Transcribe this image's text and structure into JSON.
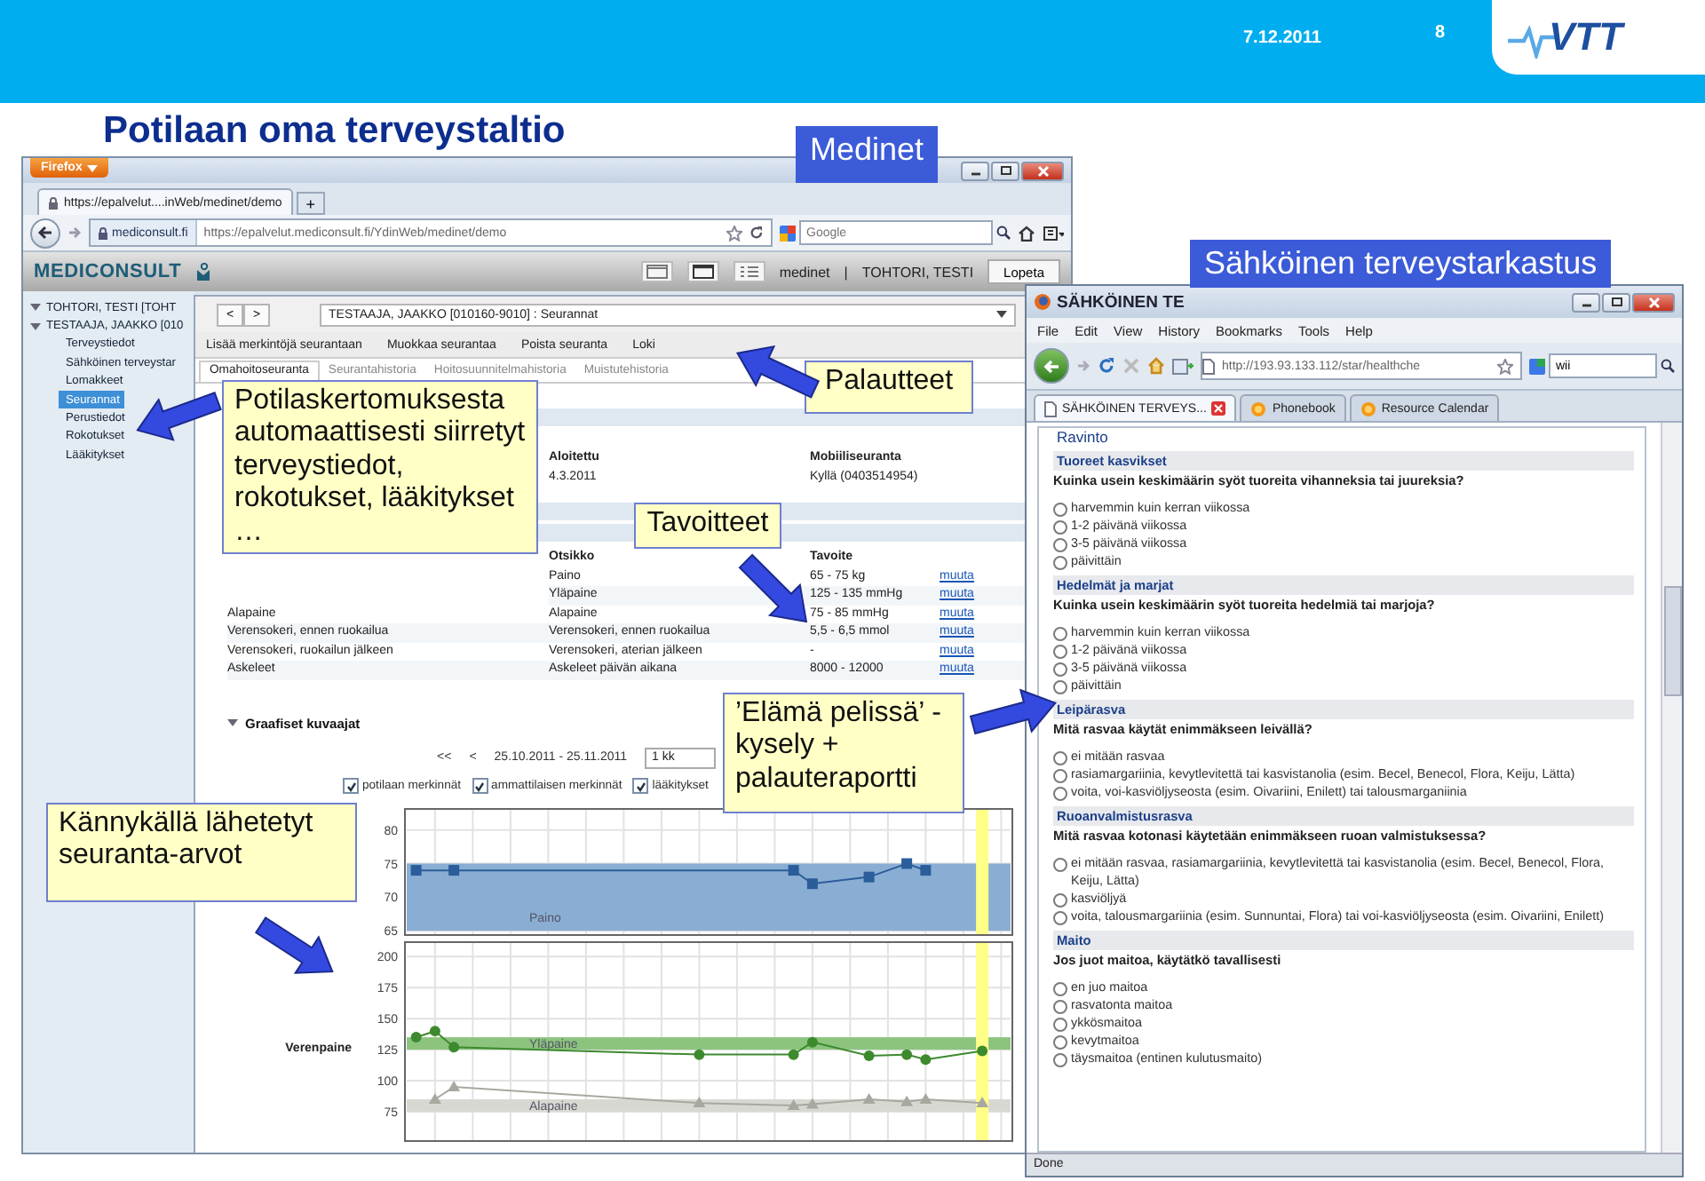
{
  "slide": {
    "date": "7.12.2011",
    "page": "8",
    "logo": "VTT",
    "title": "Potilaan oma terveystaltio"
  },
  "medinet_window": {
    "browser_button": "Firefox",
    "tabs": [
      {
        "label": "https://epalvelut....inWeb/medinet/demo",
        "selected": true
      }
    ],
    "new_tab": "+",
    "site_badge": "mediconsult.fi",
    "url": "https://epalvelut.mediconsult.fi/YdinWeb/medinet/demo",
    "search": {
      "placeholder": "Google"
    },
    "app_header": {
      "logo": "MEDICONSULT",
      "app": "medinet",
      "separator": "|",
      "user": "TOHTORI, TESTI",
      "logout": "Lopeta"
    },
    "sidebar": [
      {
        "label": "TOHTORI, TESTI [TOHT",
        "expanded": true,
        "selected": false
      },
      {
        "label": "TESTAAJA, JAAKKO [010",
        "expanded": true,
        "selected": false,
        "children": [
          {
            "label": "Terveystiedot",
            "selected": false
          },
          {
            "label": "Sähköinen terveystar",
            "selected": false
          },
          {
            "label": "Lomakkeet",
            "selected": false
          },
          {
            "label": "Seurannat",
            "selected": true
          },
          {
            "label": "Perustiedot",
            "selected": false
          },
          {
            "label": "Rokotukset",
            "selected": false
          },
          {
            "label": "Lääkitykset",
            "selected": false
          }
        ]
      }
    ],
    "nav_buttons": [
      "<",
      ">"
    ],
    "record_select": "TESTAAJA, JAAKKO  [010160-9010] : Seurannat",
    "actions": [
      "Lisää merkintöjä seurantaan",
      "Muokkaa seurantaa",
      "Poista seuranta",
      "Loki"
    ],
    "tabs2": [
      {
        "label": "Omahoitoseuranta",
        "selected": true
      },
      {
        "label": "Seurantahistoria",
        "selected": false
      },
      {
        "label": "Hoitosuunnitelmahistoria",
        "selected": false
      },
      {
        "label": "Muistutehistoria",
        "selected": false
      }
    ],
    "info": [
      {
        "label": "Aloitettu",
        "value": "4.3.2011"
      },
      {
        "label": "Mobiiliseuranta",
        "value": "Kyllä (0403514954)"
      }
    ],
    "targets": {
      "columns": [
        "Otsikko",
        "Tavoite"
      ],
      "rows": [
        {
          "title": "Paino",
          "target": "65 - 75 kg",
          "link": "muuta"
        },
        {
          "title": "Yläpaine",
          "target": "125 - 135 mmHg",
          "link": "muuta"
        },
        {
          "measure": "Alapaine",
          "title": "Alapaine",
          "target": "75 - 85 mmHg",
          "link": "muuta"
        },
        {
          "measure": "Verensokeri, ennen ruokailua",
          "title": "Verensokeri, ennen ruokailua",
          "target": "5,5 - 6,5 mmol",
          "link": "muuta"
        },
        {
          "measure": "Verensokeri, ruokailun jälkeen",
          "title": "Verensokeri, aterian jälkeen",
          "target": "-",
          "link": "muuta"
        },
        {
          "measure": "Askeleet",
          "title": "Askeleet päivän aikana",
          "target": "8000 - 12000",
          "link": "muuta"
        }
      ]
    },
    "graphs": {
      "heading": "Graafiset kuvaajat",
      "expanded": true,
      "nav": [
        "<<",
        "<"
      ],
      "range": "25.10.2011 - 25.11.2011",
      "period": "1 kk",
      "filters": [
        {
          "label": "potilaan merkinnät",
          "checked": true
        },
        {
          "label": "ammattilaisen merkinnät",
          "checked": true
        },
        {
          "label": "lääkitykset",
          "checked": true
        }
      ],
      "charts": [
        {
          "chart_data": {
            "type": "line",
            "categories": [
              null,
              null,
              null,
              null,
              null,
              null,
              null,
              null,
              null,
              null,
              null,
              null,
              null,
              null,
              null,
              null,
              null,
              null,
              null,
              null,
              null,
              null,
              null,
              null,
              null,
              null,
              null,
              null,
              null,
              null,
              null,
              null
            ],
            "ylim": [
              64.5,
              83
            ],
            "yticks": [
              65,
              70,
              75,
              80
            ],
            "series": [
              {
                "name": "Paino",
                "color": "#2a5d9a",
                "marker": "square",
                "values": [
                  74,
                  null,
                  74,
                  null,
                  null,
                  null,
                  null,
                  null,
                  null,
                  null,
                  null,
                  null,
                  null,
                  null,
                  null,
                  null,
                  null,
                  null,
                  null,
                  null,
                  74,
                  72,
                  null,
                  null,
                  73,
                  null,
                  75,
                  74,
                  null,
                  null,
                  null,
                  null
                ]
              }
            ],
            "grid": true,
            "bands": [
              {
                "axis": "y",
                "from": 65,
                "to": 75,
                "color": "#8aaed3"
              }
            ]
          }
        },
        {
          "chart_data": {
            "type": "line",
            "ylabel": "Verenpaine",
            "categories": [
              null,
              null,
              null,
              null,
              null,
              null,
              null,
              null,
              null,
              null,
              null,
              null,
              null,
              null,
              null,
              null,
              null,
              null,
              null,
              null,
              null,
              null,
              null,
              null,
              null,
              null,
              null,
              null,
              null,
              null,
              null,
              null
            ],
            "ylim": [
              52,
              211
            ],
            "yticks": [
              75,
              100,
              125,
              150,
              175,
              200
            ],
            "series": [
              {
                "name": "Yläpaine",
                "color": "#3d8a2e",
                "marker": "circle",
                "values": [
                  135,
                  140,
                  127,
                  null,
                  null,
                  null,
                  null,
                  null,
                  null,
                  null,
                  null,
                  null,
                  null,
                  null,
                  null,
                  121,
                  null,
                  null,
                  null,
                  null,
                  121,
                  131,
                  null,
                  null,
                  120,
                  null,
                  121,
                  117,
                  null,
                  null,
                  124,
                  null
                ]
              },
              {
                "name": "Alapaine",
                "color": "#a8a8a0",
                "marker": "triangle",
                "values": [
                  null,
                  85,
                  95,
                  null,
                  null,
                  null,
                  null,
                  null,
                  null,
                  null,
                  null,
                  null,
                  null,
                  null,
                  null,
                  82,
                  null,
                  null,
                  null,
                  null,
                  80,
                  81,
                  null,
                  null,
                  85,
                  null,
                  83,
                  85,
                  null,
                  null,
                  82,
                  null
                ]
              }
            ],
            "grid": true,
            "bands": [
              {
                "axis": "y",
                "from": 125,
                "to": 135,
                "color": "#8cc47e"
              },
              {
                "axis": "y",
                "from": 75,
                "to": 85,
                "color": "#d8d8d2"
              }
            ]
          }
        }
      ]
    }
  },
  "checkup_window": {
    "title": "SÄHKÖINEN TE",
    "menu": [
      "File",
      "Edit",
      "View",
      "History",
      "Bookmarks",
      "Tools",
      "Help"
    ],
    "url": "http://193.93.133.112/star/healthche",
    "search": {
      "value": "wii"
    },
    "tabs": [
      {
        "label": "SÄHKÖINEN TERVEYS...",
        "selected": true
      },
      {
        "label": "Phonebook",
        "selected": false
      },
      {
        "label": "Resource Calendar",
        "selected": false
      }
    ],
    "legend": "Ravinto",
    "questions": [
      {
        "topic": "Tuoreet kasvikset",
        "question": "Kuinka usein keskimäärin syöt tuoreita vihanneksia tai juureksia?",
        "options": [
          {
            "label": "harvemmin kuin kerran viikossa",
            "selected": false
          },
          {
            "label": "1-2 päivänä viikossa",
            "selected": false
          },
          {
            "label": "3-5 päivänä viikossa",
            "selected": false
          },
          {
            "label": "päivittäin",
            "selected": false
          }
        ]
      },
      {
        "topic": "Hedelmät ja marjat",
        "question": "Kuinka usein keskimäärin syöt tuoreita hedelmiä tai marjoja?",
        "options": [
          {
            "label": "harvemmin kuin kerran viikossa",
            "selected": false
          },
          {
            "label": "1-2 päivänä viikossa",
            "selected": false
          },
          {
            "label": "3-5 päivänä viikossa",
            "selected": false
          },
          {
            "label": "päivittäin",
            "selected": false
          }
        ]
      },
      {
        "topic": "Leipärasva",
        "question": "Mitä rasvaa käytät enimmäkseen leivällä?",
        "options": [
          {
            "label": "ei mitään rasvaa",
            "selected": false
          },
          {
            "label": "rasiamargariinia, kevytlevitettä tai kasvistanolia (esim. Becel, Benecol, Flora, Keiju, Lätta)",
            "selected": false
          },
          {
            "label": "voita, voi-kasviöljyseosta (esim. Oivariini, Enilett) tai talousmarganiinia",
            "selected": false
          }
        ]
      },
      {
        "topic": "Ruoanvalmistusrasva",
        "question": "Mitä rasvaa kotonasi käytetään enimmäkseen ruoan valmistuksessa?",
        "options": [
          {
            "label": "ei mitään rasvaa, rasiamargariinia, kevytlevitettä tai kasvistanolia (esim. Becel, Benecol, Flora, Keiju, Lätta)",
            "selected": false
          },
          {
            "label": "kasviöljyä",
            "selected": false
          },
          {
            "label": "voita, talousmargariinia (esim. Sunnuntai, Flora) tai voi-kasviöljyseosta (esim. Oivariini, Enilett)",
            "selected": false
          }
        ]
      },
      {
        "topic": "Maito",
        "question": "Jos juot maitoa, käytätkö tavallisesti",
        "options": [
          {
            "label": "en juo maitoa",
            "selected": false
          },
          {
            "label": "rasvatonta maitoa",
            "selected": false
          },
          {
            "label": "ykkösmaitoa",
            "selected": false
          },
          {
            "label": "kevytmaitoa",
            "selected": false
          },
          {
            "label": "täysmaitoa (entinen kulutusmaito)",
            "selected": false
          }
        ]
      }
    ],
    "status": "Done"
  },
  "callouts": [
    {
      "kind": "label",
      "text": "Medinet"
    },
    {
      "kind": "label",
      "text": "Sähköinen terveystarkastus"
    },
    {
      "kind": "note",
      "text": "Potilaskertomuksesta automaattisesti siirretyt terveystiedot, rokotukset, lääkitykset …"
    },
    {
      "kind": "note",
      "text": "Palautteet"
    },
    {
      "kind": "note",
      "text": "Tavoitteet"
    },
    {
      "kind": "note",
      "text": "’Elämä pelissä’ -kysely + palauteraportti"
    },
    {
      "kind": "note",
      "text": "Kännykällä lähetetyt seuranta-arvot"
    }
  ]
}
